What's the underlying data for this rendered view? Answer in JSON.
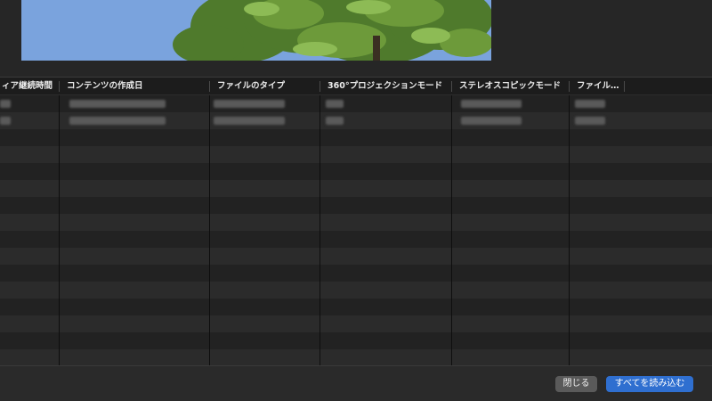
{
  "table": {
    "columns": [
      {
        "label": "ィア継続時間"
      },
      {
        "label": "コンテンツの作成日"
      },
      {
        "label": "ファイルのタイプ"
      },
      {
        "label": "360°プロジェクションモード"
      },
      {
        "label": "ステレオスコピックモード"
      },
      {
        "label": "ファイル…"
      }
    ]
  },
  "footer": {
    "close_label": "閉じる",
    "import_all_label": "すべてを読み込む"
  },
  "colors": {
    "accent": "#2f6fd0",
    "background": "#2a2a2a",
    "row_odd": "#222222",
    "row_even": "#2b2b2b"
  }
}
